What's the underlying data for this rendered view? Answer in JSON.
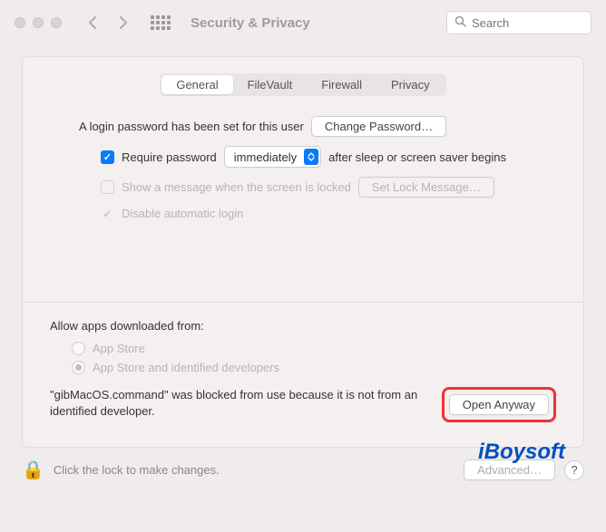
{
  "window": {
    "title": "Security & Privacy",
    "search_placeholder": "Search"
  },
  "tabs": {
    "general": "General",
    "filevault": "FileVault",
    "firewall": "Firewall",
    "privacy": "Privacy"
  },
  "login": {
    "password_set_text": "A login password has been set for this user",
    "change_password_btn": "Change Password…",
    "require_password_label": "Require password",
    "require_password_dropdown": "immediately",
    "require_password_suffix": "after sleep or screen saver begins",
    "show_message_label": "Show a message when the screen is locked",
    "set_lock_message_btn": "Set Lock Message…",
    "disable_auto_login_label": "Disable automatic login"
  },
  "allow_apps": {
    "heading": "Allow apps downloaded from:",
    "app_store": "App Store",
    "app_store_identified": "App Store and identified developers",
    "blocked_message": "\"gibMacOS.command\" was blocked from use because it is not from an identified developer.",
    "open_anyway_btn": "Open Anyway"
  },
  "footer": {
    "lock_text": "Click the lock to make changes.",
    "advanced_btn": "Advanced…",
    "help": "?"
  },
  "watermark": "iBoysoft"
}
